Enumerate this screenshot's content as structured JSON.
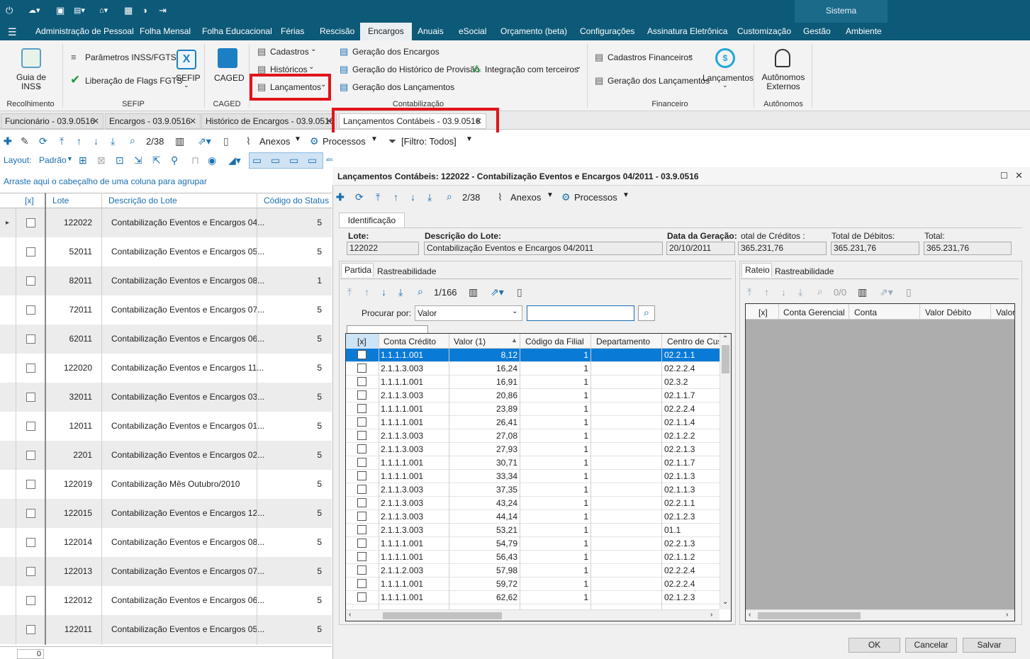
{
  "window": {
    "section_label": "Sistema"
  },
  "quick_access": {
    "icons": [
      "power-icon",
      "cloud-sync-icon",
      "camera-icon",
      "image-icon",
      "home-icon",
      "grid-icon",
      "globe-icon",
      "exit-icon"
    ]
  },
  "menu": {
    "items": [
      "Administração de Pessoal",
      "Folha Mensal",
      "Folha Educacional",
      "Férias",
      "Rescisão",
      "Encargos",
      "Anuais",
      "eSocial",
      "Orçamento (beta)",
      "Configurações",
      "Assinatura Eletrônica",
      "Customização",
      "Gestão",
      "Ambiente"
    ],
    "active": "Encargos"
  },
  "ribbon": {
    "guia_inss": "Guia de INSS",
    "recolhimento": "Recolhimento",
    "parametros": "Parâmetros INSS/FGTS",
    "liberacao": "Liberação de Flags FGTS",
    "sefip": "SEFIP",
    "sefip_group": "SEFIP",
    "caged": "CAGED",
    "caged_group": "CAGED",
    "cadastros": "Cadastros",
    "historicos": "Históricos",
    "lancamentos": "Lançamentos",
    "geracao_encargos": "Geração dos Encargos",
    "geracao_historico": "Geração do Histórico de Provisão",
    "geracao_lancamentos": "Geração dos Lançamentos",
    "integracao": "Integração com terceiros",
    "contabilizacao_group": "Contabilização",
    "cad_financeiros": "Cadastros Financeiros",
    "geracao_lanc_fin": "Geração dos Lançamentos",
    "lancamentos_fin": "Lançamentos",
    "financeiro_group": "Financeiro",
    "autonomos": "Autônomos Externos",
    "autonomos_group": "Autônomos"
  },
  "doc_tabs": [
    "Funcionário - 03.9.0516",
    "Encargos - 03.9.0516",
    "Histórico de Encargos - 03.9.0516",
    "Lançamentos Contábeis - 03.9.0516"
  ],
  "toolbar": {
    "record_pos": "2/38",
    "anexos": "Anexos",
    "processos": "Processos",
    "filtro": "[Filtro: Todos]",
    "layout_label": "Layout:",
    "layout_value": "Padrão"
  },
  "main_grid": {
    "group_hint": "Arraste aqui o cabeçalho de uma coluna para agrupar",
    "headers": [
      "[x]",
      "Lote",
      "Descrição do Lote",
      "Código do Status"
    ],
    "rows": [
      {
        "lote": "122022",
        "desc": "Contabilização Eventos e Encargos 04...",
        "status": "5"
      },
      {
        "lote": "52011",
        "desc": "Contabilização Eventos e Encargos 05...",
        "status": "5"
      },
      {
        "lote": "82011",
        "desc": "Contabilização Eventos e Encargos 08...",
        "status": "1"
      },
      {
        "lote": "72011",
        "desc": "Contabilização Eventos e Encargos 07...",
        "status": "5"
      },
      {
        "lote": "62011",
        "desc": "Contabilização Eventos e Encargos 06...",
        "status": "5"
      },
      {
        "lote": "122020",
        "desc": "Contabilização Eventos e Encargos 11...",
        "status": "5"
      },
      {
        "lote": "32011",
        "desc": "Contabilização Eventos e Encargos 03...",
        "status": "5"
      },
      {
        "lote": "12011",
        "desc": "Contabilização Eventos e Encargos 01...",
        "status": "5"
      },
      {
        "lote": "2201",
        "desc": "Contabilização Eventos e Encargos 02...",
        "status": "5"
      },
      {
        "lote": "122019",
        "desc": "Contabilização Mês Outubro/2010",
        "status": "5"
      },
      {
        "lote": "122015",
        "desc": "Contabilização Eventos e Encargos 12...",
        "status": "5"
      },
      {
        "lote": "122014",
        "desc": "Contabilização Eventos e Encargos 08...",
        "status": "5"
      },
      {
        "lote": "122013",
        "desc": "Contabilização Eventos e Encargos 07...",
        "status": "5"
      },
      {
        "lote": "122012",
        "desc": "Contabilização Eventos e Encargos 06...",
        "status": "5"
      },
      {
        "lote": "122011",
        "desc": "Contabilização Eventos e Encargos 05...",
        "status": "5"
      }
    ],
    "footer_value": "0"
  },
  "dialog": {
    "title": "Lançamentos Contábeis: 122022 - Contabilização Eventos e Encargos 04/2011 - 03.9.0516",
    "record_pos": "2/38",
    "anexos": "Anexos",
    "processos": "Processos",
    "tab": "Identificação",
    "lote_label": "Lote:",
    "lote": "122022",
    "desc_label": "Descrição do Lote:",
    "desc": "Contabilização Eventos e Encargos 04/2011",
    "data_label": "Data da Geração:",
    "data": "20/10/2011",
    "creditos_label": "otal de Créditos :",
    "creditos": "365.231,76",
    "debitos_label": "Total de Débitos:",
    "debitos": "365.231,76",
    "total_label": "Total:",
    "total": "365.231,76",
    "partida_tab": "Partida",
    "rastre_tab": "Rastreabilidade",
    "partida_pos": "1/166",
    "procurar_label": "Procurar por:",
    "procurar_value": "Valor",
    "search_value": "",
    "partida_headers": [
      "[x]",
      "Conta Crédito",
      "Valor (1)",
      "Código da Filial",
      "Departamento",
      "Centro de Custo"
    ],
    "partida_rows": [
      [
        "1.1.1.1.001",
        "8,12",
        "1",
        "",
        "02.2.1.1"
      ],
      [
        "2.1.1.3.003",
        "16,24",
        "1",
        "",
        "02.2.2.4"
      ],
      [
        "1.1.1.1.001",
        "16,91",
        "1",
        "",
        "02.3.2"
      ],
      [
        "2.1.1.3.003",
        "20,86",
        "1",
        "",
        "02.1.1.7"
      ],
      [
        "1.1.1.1.001",
        "23,89",
        "1",
        "",
        "02.2.2.4"
      ],
      [
        "1.1.1.1.001",
        "26,41",
        "1",
        "",
        "02.1.1.4"
      ],
      [
        "2.1.1.3.003",
        "27,08",
        "1",
        "",
        "02.1.2.2"
      ],
      [
        "2.1.1.3.003",
        "27,93",
        "1",
        "",
        "02.2.1.3"
      ],
      [
        "1.1.1.1.001",
        "30,71",
        "1",
        "",
        "02.1.1.7"
      ],
      [
        "1.1.1.1.001",
        "33,34",
        "1",
        "",
        "02.1.1.3"
      ],
      [
        "2.1.1.3.003",
        "37,35",
        "1",
        "",
        "02.1.1.3"
      ],
      [
        "2.1.1.3.003",
        "43,24",
        "1",
        "",
        "02.2.1.1"
      ],
      [
        "2.1.1.3.003",
        "44,14",
        "1",
        "",
        "02.1.2.3"
      ],
      [
        "2.1.1.3.003",
        "53,21",
        "1",
        "",
        "01.1"
      ],
      [
        "1.1.1.1.001",
        "54,79",
        "1",
        "",
        "02.2.1.3"
      ],
      [
        "1.1.1.1.001",
        "56,43",
        "1",
        "",
        "02.1.1.2"
      ],
      [
        "2.1.1.2.003",
        "57,98",
        "1",
        "",
        "02.2.2.4"
      ],
      [
        "1.1.1.1.001",
        "59,72",
        "1",
        "",
        "02.2.2.4"
      ],
      [
        "1.1.1.1.001",
        "62,62",
        "1",
        "",
        "02.1.2.3"
      ]
    ],
    "rateio_tab": "Rateio",
    "rateio_rastre_tab": "Rastreabilidade",
    "rateio_pos": "0/0",
    "rateio_headers": [
      "[x]",
      "Conta Gerencial",
      "Conta",
      "Valor Débito",
      "Valor"
    ],
    "ok": "OK",
    "cancelar": "Cancelar",
    "salvar": "Salvar"
  }
}
